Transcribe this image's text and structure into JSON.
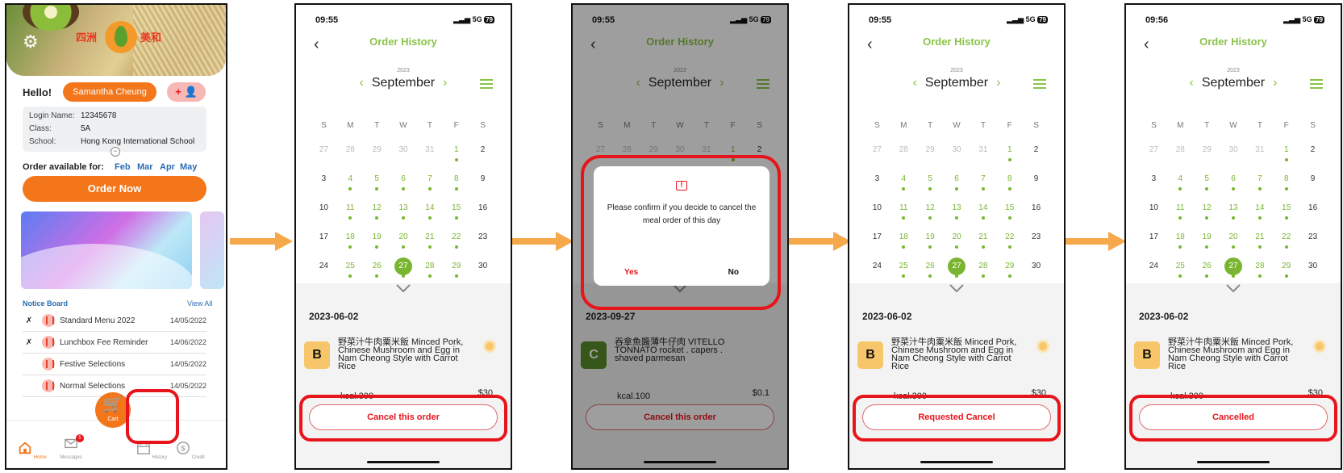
{
  "home": {
    "hello": "Hello!",
    "user_name": "Samantha Cheung",
    "add_user": "+ 👤",
    "logo_left": "四洲",
    "logo_right": "美和",
    "info": [
      {
        "label": "Login Name:",
        "value": "12345678"
      },
      {
        "label": "Class:",
        "value": "5A"
      },
      {
        "label": "School:",
        "value": "Hong Kong International School"
      }
    ],
    "order_available": "Order available for:",
    "months": [
      "Feb",
      "Mar",
      "Apr",
      "May"
    ],
    "order_now": "Order Now",
    "notice_board": "Notice Board",
    "view_all": "View All",
    "notices": [
      {
        "title": "Standard Menu 2022",
        "date": "14/05/2022",
        "pinned": true
      },
      {
        "title": "Lunchbox Fee Reminder",
        "date": "14/06/2022",
        "pinned": true
      },
      {
        "title": "Festive Selections",
        "date": "14/05/2022",
        "pinned": false
      },
      {
        "title": "Normal Selections",
        "date": "14/05/2022",
        "pinned": false
      }
    ],
    "nav": {
      "home": "Home",
      "messages": "Messages",
      "cart": "Cart",
      "history": "History",
      "credit": "Credit",
      "messages_badge": "5"
    }
  },
  "history": {
    "title": "Order History",
    "year": "2023",
    "month": "September",
    "weekdays": [
      "S",
      "M",
      "T",
      "W",
      "T",
      "F",
      "S"
    ],
    "weeks": [
      [
        "27",
        "28",
        "29",
        "30",
        "31",
        "1",
        "2"
      ],
      [
        "3",
        "4",
        "5",
        "6",
        "7",
        "8",
        "9"
      ],
      [
        "10",
        "11",
        "12",
        "13",
        "14",
        "15",
        "16"
      ],
      [
        "17",
        "18",
        "19",
        "20",
        "21",
        "22",
        "23"
      ],
      [
        "24",
        "25",
        "26",
        "27",
        "28",
        "29",
        "30"
      ]
    ],
    "selected_day": "27"
  },
  "screens": [
    {
      "time": "09:55",
      "signal": "5G",
      "battery": "79",
      "date": "2023-06-02",
      "badge": "B",
      "meal": "野菜汁牛肉粟米飯 Minced Pork, Chinese Mushroom and Egg in Nam Cheong Style with Carrot Rice",
      "kcal": "kcal.300",
      "price": "$30",
      "action": "Cancel this order"
    },
    {
      "time": "09:55",
      "signal": "5G",
      "battery": "79",
      "date": "2023-09-27",
      "badge": "C",
      "meal": "吞拿魚醬薄牛仔肉 VITELLO TONNATO rocket . capers . shaved parmesan",
      "kcal": "kcal.100",
      "price": "$0.1",
      "action": "Cancel this order",
      "dialog": {
        "message": "Please confirm if you decide to cancel the meal order of this day",
        "yes": "Yes",
        "no": "No"
      }
    },
    {
      "time": "09:55",
      "signal": "5G",
      "battery": "79",
      "date": "2023-06-02",
      "badge": "B",
      "meal": "野菜汁牛肉粟米飯 Minced Pork, Chinese Mushroom and Egg in Nam Cheong Style with Carrot Rice",
      "kcal": "kcal.300",
      "price": "$30",
      "action": "Requested Cancel"
    },
    {
      "time": "09:56",
      "signal": "5G",
      "battery": "79",
      "date": "2023-06-02",
      "badge": "B",
      "meal": "野菜汁牛肉粟米飯 Minced Pork, Chinese Mushroom and Egg in Nam Cheong Style with Carrot Rice",
      "kcal": "kcal.300",
      "price": "$30",
      "action": "Cancelled"
    }
  ],
  "colors": {
    "brand_orange": "#f4761b",
    "accent_green": "#7ab531",
    "highlight_red": "#e8141b",
    "arrow": "#f5a94a"
  }
}
